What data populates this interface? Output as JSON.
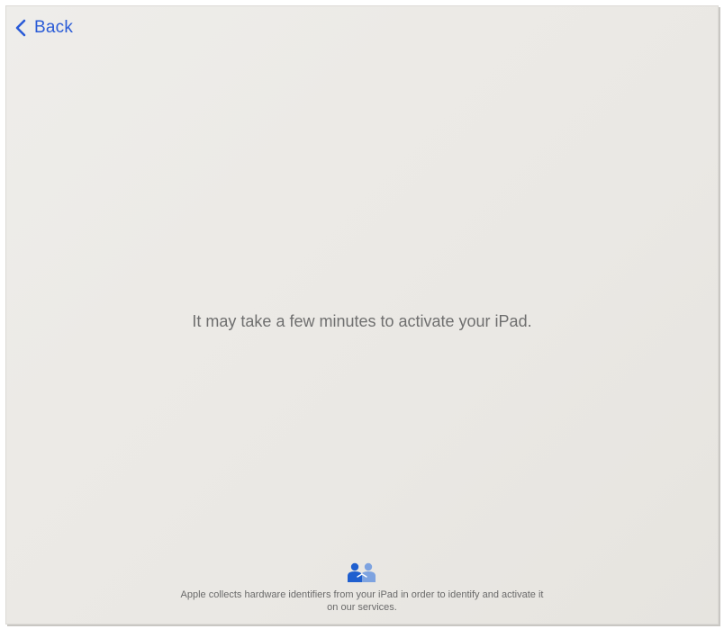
{
  "nav": {
    "back_label": "Back"
  },
  "main": {
    "message": "It may take a few minutes to activate your iPad."
  },
  "footer": {
    "icon": "privacy-people-icon",
    "text_line1": "Apple collects hardware identifiers from your iPad in order to identify and activate it",
    "text_line2": "on our services."
  },
  "colors": {
    "accent": "#2a5bd7",
    "icon_primary": "#1f5fcf",
    "icon_secondary": "#7ea3e0",
    "background": "#ebe9e5",
    "text_primary": "#6f6f6f"
  }
}
